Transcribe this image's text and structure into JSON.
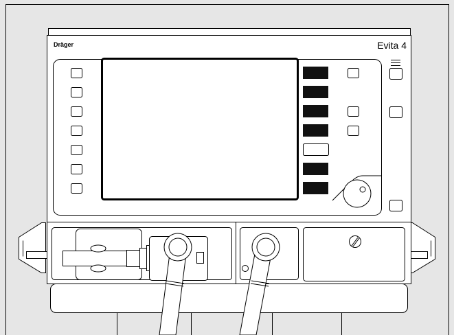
{
  "device": {
    "brand": "Dräger",
    "model": "Evita 4"
  },
  "colors": {
    "background": "#e6e6e6",
    "housing": "#ffffff",
    "outline": "#000000",
    "screen_border": "#000000"
  },
  "icons": {
    "left_keys": "square-button-icon",
    "dark_keys": "black-key-icon",
    "rotary_knob": "knob-icon",
    "screw": "slotted-screw-icon",
    "hoses": "breathing-hose-icon"
  }
}
